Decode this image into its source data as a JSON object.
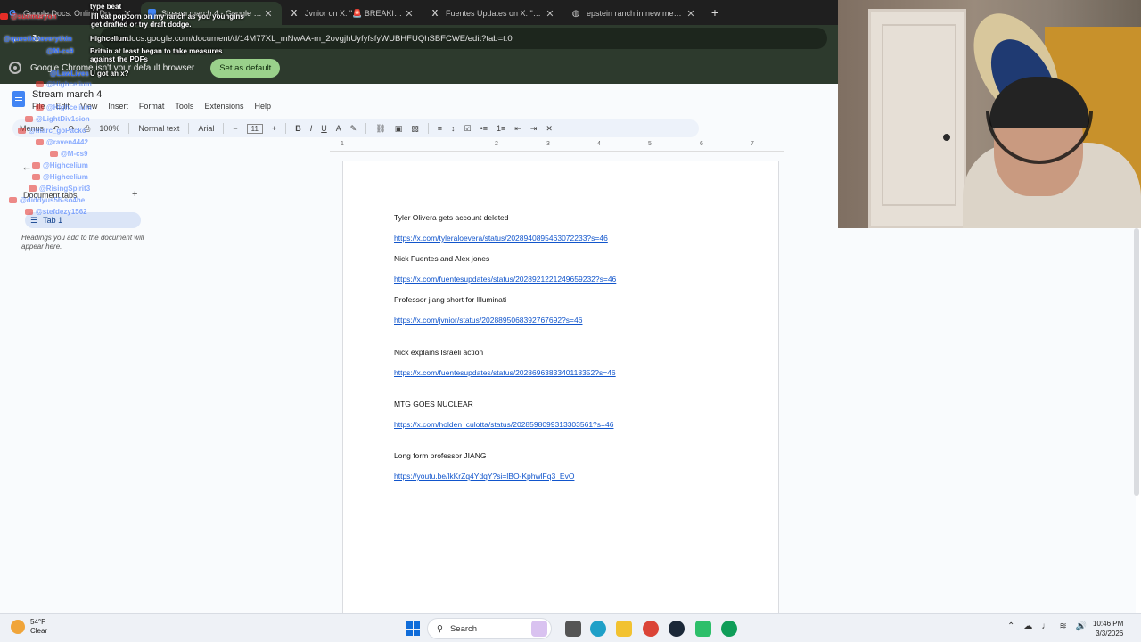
{
  "browser": {
    "tabs": [
      {
        "title": "Google Docs: Online Docume",
        "icon": "google-g-icon"
      },
      {
        "title": "Stream march 4 - Google Docs",
        "icon": "docs-icon"
      },
      {
        "title": "Jvnior on X: \"🚨 BREAKING:",
        "icon": "x-icon"
      },
      {
        "title": "Fuentes Updates on X: \"Nick Fu",
        "icon": "x-icon"
      },
      {
        "title": "epstein ranch in new mexico bo",
        "icon": "globe-icon"
      }
    ],
    "url": "docs.google.com/document/d/14M77XL_mNwAA-m_2ovgjhUyfyfsfyWUBHFUQhSBFCWE/edit?tab=t.0",
    "infobar_text": "Google Chrome isn't your default browser",
    "set_default_label": "Set as default"
  },
  "docs": {
    "title": "Stream march 4",
    "menu": [
      "File",
      "Edit",
      "View",
      "Insert",
      "Format",
      "Tools",
      "Extensions",
      "Help"
    ],
    "toolbar": {
      "menus": "Menus",
      "zoom": "100%",
      "style": "Normal text",
      "font": "Arial",
      "size": "11"
    },
    "ruler": [
      "1",
      "2",
      "3",
      "4",
      "5",
      "6",
      "7"
    ],
    "left_panel": {
      "doc_tabs_label": "Document tabs",
      "add_label": "+",
      "tab1": "Tab 1",
      "hint": "Headings you add to the document will appear here."
    },
    "entries": [
      {
        "title": "Tyler Olivera gets account deleted",
        "link": "https://x.com/tyleraloevera/status/2028940895463072233?s=46"
      },
      {
        "title": "Nick Fuentes and Alex jones",
        "link": "https://x.com/fuentesupdates/status/2028921221249659232?s=46"
      },
      {
        "title": "Professor jiang short for Illuminati",
        "link": "https://x.com/jvnior/status/2028895068392767692?s=46"
      },
      {
        "title": "Nick explains Israeli action",
        "link": "https://x.com/fuentesupdates/status/2028696383340118352?s=46"
      },
      {
        "title": "MTG GOES NUCLEAR",
        "link": "https://x.com/holden_culotta/status/2028598099313303561?s=46"
      },
      {
        "title": "Long form professor JIANG",
        "link": "https://youtu.be/lkKrZq4YdqY?si=lBO-KphwlFq3_EvO"
      }
    ]
  },
  "chat": [
    {
      "user": "",
      "msg": "type beat"
    },
    {
      "user": "@suomuryon",
      "msg": "I'll eat popcorn on my ranch as you youngins get drafted or try draft dodge."
    },
    {
      "user": "@questioneverythin",
      "msg": "Highcelium"
    },
    {
      "user": "@M-cs9",
      "msg": "Britain at least began to take measures against the PDFs"
    },
    {
      "user": "@LawLives",
      "msg": "U got an x?"
    },
    {
      "user": "@Highcelium",
      "msg": ""
    },
    {
      "user": "@Highcelium",
      "msg": ""
    },
    {
      "user": "@LightDiv1sion",
      "msg": ""
    },
    {
      "user": "@marc_goPacko",
      "msg": ""
    },
    {
      "user": "@raven4442",
      "msg": ""
    },
    {
      "user": "@M-cs9",
      "msg": ""
    },
    {
      "user": "@Highcelium",
      "msg": ""
    },
    {
      "user": "@Highcelium",
      "msg": ""
    },
    {
      "user": "@RisingSpirit3",
      "msg": ""
    },
    {
      "user": "@diddyus56-so4he",
      "msg": ""
    },
    {
      "user": "@stefdezy1562",
      "msg": ""
    }
  ],
  "taskbar": {
    "temp": "54°F",
    "condition": "Clear",
    "search_label": "Search",
    "time": "10:46 PM",
    "date": "3/3/2026"
  },
  "colors": {
    "link": "#1155cc",
    "chrome_bg": "#2d3a2d",
    "docs_bg": "#f9fbfd"
  }
}
